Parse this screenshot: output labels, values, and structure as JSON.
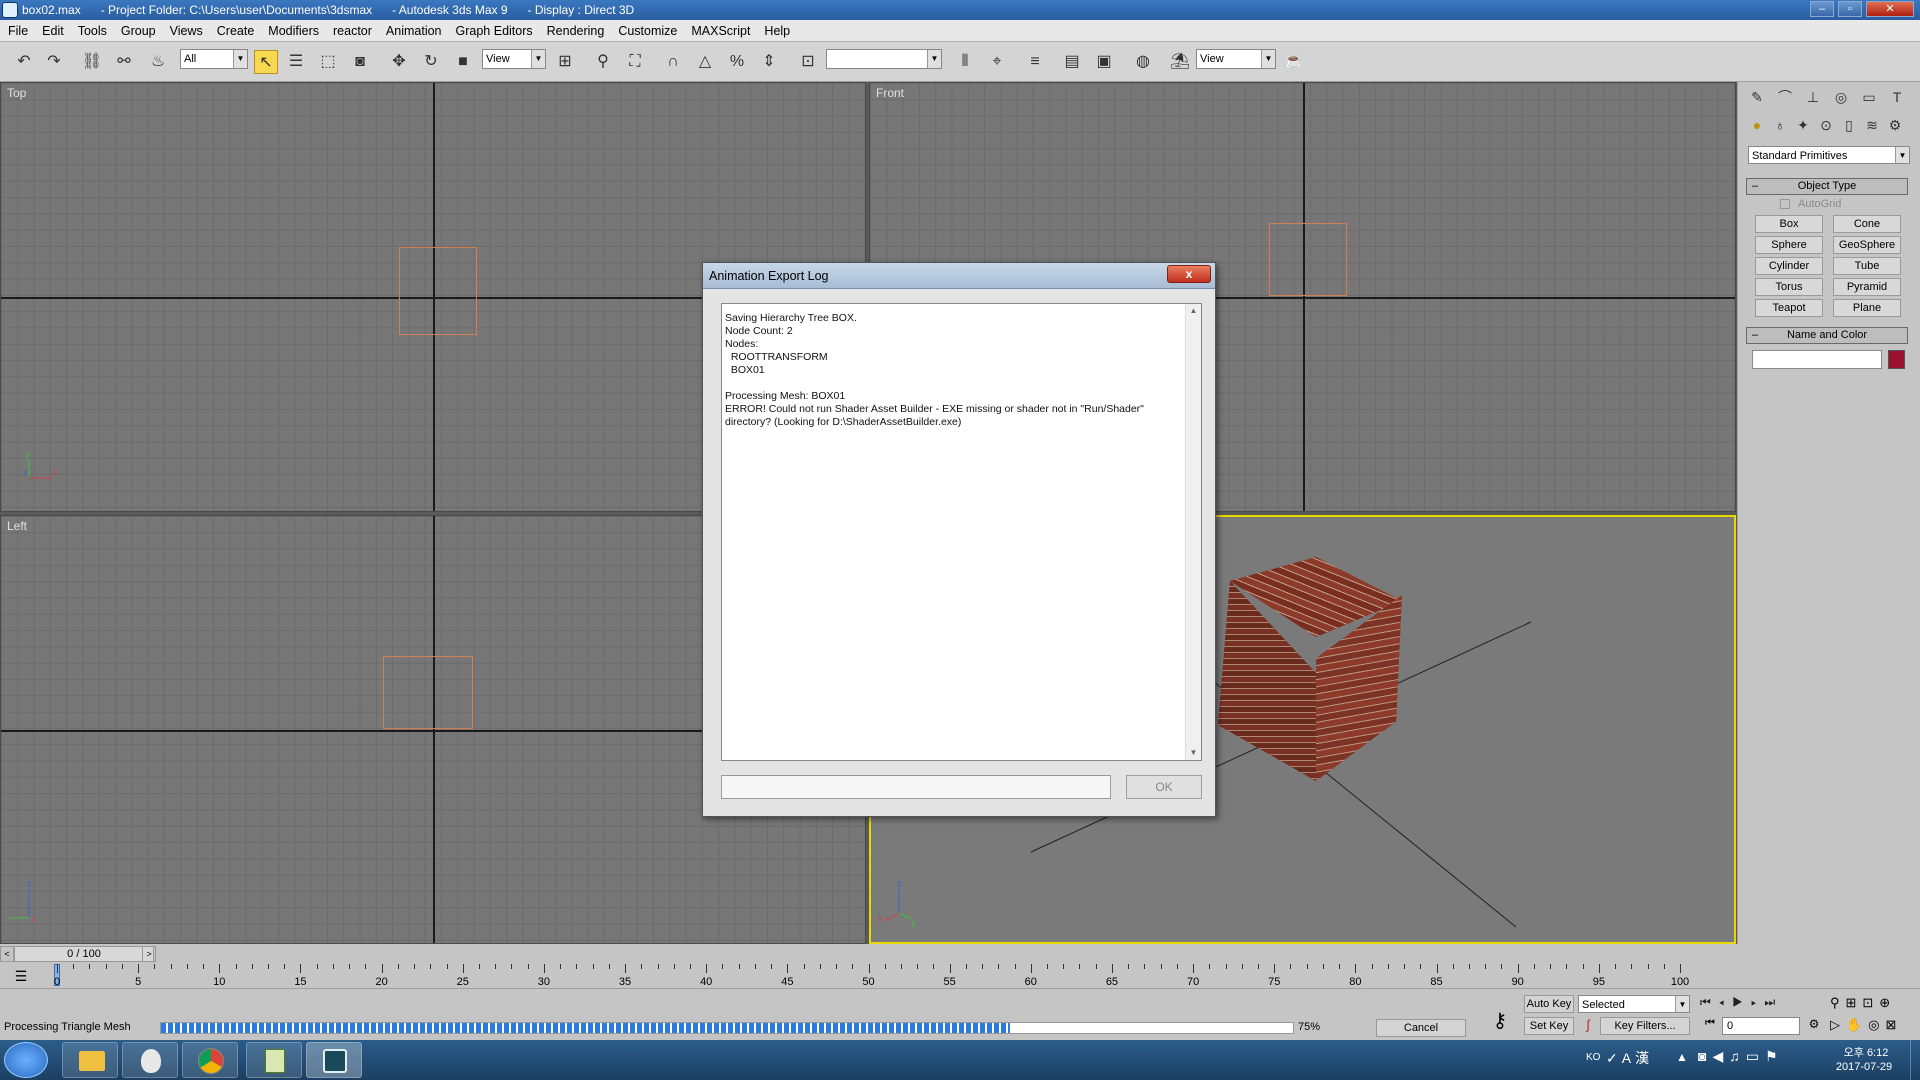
{
  "window": {
    "title": "box02.max      - Project Folder: C:\\Users\\user\\Documents\\3dsmax      - Autodesk 3ds Max 9      - Display : Direct 3D",
    "min_label": "–",
    "max_label": "▫",
    "close_label": "✕"
  },
  "menu": [
    "File",
    "Edit",
    "Tools",
    "Group",
    "Views",
    "Create",
    "Modifiers",
    "reactor",
    "Animation",
    "Graph Editors",
    "Rendering",
    "Customize",
    "MAXScript",
    "Help"
  ],
  "toolbar": {
    "selection_filter": "All",
    "ref_coord": "View",
    "named_selection": "",
    "view_select": "View"
  },
  "viewports": {
    "top": "Top",
    "front": "Front",
    "left": "Left",
    "perspective": ""
  },
  "dialog": {
    "title": "Animation Export Log",
    "close_label": "x",
    "log": "Saving Hierarchy Tree BOX.\nNode Count: 2\nNodes:\n  ROOTTRANSFORM\n  BOX01\n\nProcessing Mesh: BOX01\nERROR! Could not run Shader Asset Builder - EXE missing or shader not in \"Run/Shader\"\ndirectory? (Looking for D:\\ShaderAssetBuilder.exe)",
    "field": "",
    "ok": "OK"
  },
  "cmdpanel": {
    "category": "Standard Primitives",
    "object_type": "Object Type",
    "autogrid": "AutoGrid",
    "buttons": [
      "Box",
      "Cone",
      "Sphere",
      "GeoSphere",
      "Cylinder",
      "Tube",
      "Torus",
      "Pyramid",
      "Teapot",
      "Plane"
    ],
    "name_color": "Name and Color",
    "name_value": "",
    "object_color": "#9c1030"
  },
  "trackbar": {
    "frame": "0 / 100"
  },
  "timeline": {
    "ticks": [
      "0",
      "5",
      "10",
      "15",
      "20",
      "25",
      "30",
      "35",
      "40",
      "45",
      "50",
      "55",
      "60",
      "65",
      "70",
      "75",
      "80",
      "85",
      "90",
      "95",
      "100"
    ]
  },
  "status": {
    "text": "Processing Triangle Mesh",
    "progress_fraction": 0.75,
    "percent": "75%",
    "cancel": "Cancel",
    "auto_key": "Auto Key",
    "set_key": "Set Key",
    "key_mode": "Selected",
    "key_filters": "Key Filters...",
    "frame_value": "0"
  },
  "taskbar": {
    "lang": "KO",
    "time_prefix": "오후",
    "time": "6:12",
    "date": "2017-07-29"
  }
}
